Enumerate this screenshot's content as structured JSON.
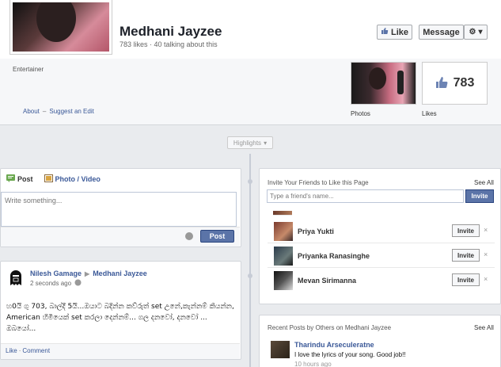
{
  "header": {
    "page_name": "Medhani Jayzee",
    "page_stats": "783 likes · 40 talking about this",
    "like_label": "Like",
    "message_label": "Message",
    "category": "Entertainer",
    "about_label": "About",
    "about_sep": "–",
    "suggest_edit_label": "Suggest an Edit",
    "photos_label": "Photos",
    "likes_count": "783",
    "likes_label": "Likes"
  },
  "timeline": {
    "highlights_label": "Highlights"
  },
  "composer": {
    "tab_post": "Post",
    "tab_photo_video": "Photo / Video",
    "placeholder": "Write something...",
    "post_button": "Post"
  },
  "story": {
    "author": "Nilesh Gamage",
    "target": "Medhani Jayzee",
    "time": "2 seconds ago",
    "text": "හ0යි ගු 703, බාල්දී 5යි...ඔයාට බදින්න කව්රුත් set උනේ,කැන්නම් කියන්න, American හිමියෙක් set කරලා දෙන්නම්... ගල දනවෝ, දනවෝ ... ඔබයෝ...",
    "like_label": "Like",
    "sep": "·",
    "comment_label": "Comment"
  },
  "invite": {
    "title": "Invite Your Friends to Like this Page",
    "see_all": "See All",
    "input_placeholder": "Type a friend's name...",
    "invite_button": "Invite",
    "friends": [
      {
        "name": "Priya Yukti",
        "button": "Invite",
        "close": "×"
      },
      {
        "name": "Priyanka Ranasinghe",
        "button": "Invite",
        "close": "×"
      },
      {
        "name": "Mevan Sirimanna",
        "button": "Invite",
        "close": "×"
      }
    ]
  },
  "recent": {
    "title": "Recent Posts by Others on Medhani Jayzee",
    "see_all": "See All",
    "author": "Tharindu Arseculeratne",
    "text": "I love the lyrics of your song. Good job!!",
    "time": "10 hours ago"
  },
  "colors": {
    "link": "#3b5998",
    "primary_button": "#5b74a8",
    "background": "#e9ebee"
  }
}
